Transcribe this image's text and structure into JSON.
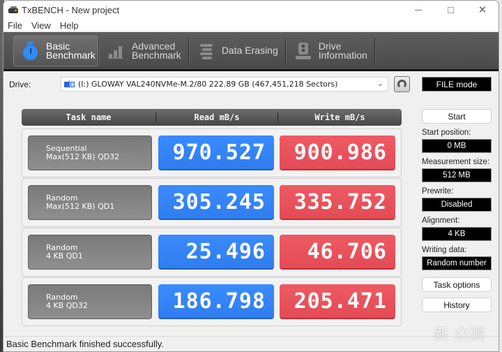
{
  "window": {
    "title": "TxBENCH - New project",
    "controls": {
      "minimize": "—",
      "maximize": "□",
      "close": "✕"
    }
  },
  "menu": [
    "File",
    "View",
    "Help"
  ],
  "toolbar": {
    "tabs": [
      {
        "line1": "Basic",
        "line2": "Benchmark",
        "icon": "stopwatch-icon",
        "active": true
      },
      {
        "line1": "Advanced",
        "line2": "Benchmark",
        "icon": "bar-chart-icon",
        "active": false
      },
      {
        "line1": "Data Erasing",
        "line2": "",
        "icon": "eraser-spring-icon",
        "active": false
      },
      {
        "line1": "Drive",
        "line2": "Information",
        "icon": "drive-info-icon",
        "active": false
      }
    ]
  },
  "drive": {
    "label": "Drive:",
    "selected": "(I:) GLOWAY VAL240NVMe-M.2/80  222.89 GB (467,451,218 Sectors)",
    "mode": "FILE mode"
  },
  "grid": {
    "headers": {
      "task": "Task name",
      "read": "Read mB/s",
      "write": "Write mB/s"
    },
    "rows": [
      {
        "line1": "Sequential",
        "line2": "Max(512 KB) QD32",
        "read": "970.527",
        "write": "900.986"
      },
      {
        "line1": "Random",
        "line2": "Max(512 KB) QD1",
        "read": "305.245",
        "write": "335.752"
      },
      {
        "line1": "Random",
        "line2": "4 KB QD1",
        "read": "25.496",
        "write": "46.706"
      },
      {
        "line1": "Random",
        "line2": "4 KB QD32",
        "read": "186.798",
        "write": "205.471"
      }
    ]
  },
  "side": {
    "start_label": "Start",
    "start_position_label": "Start position:",
    "start_position": "0 MB",
    "measurement_size_label": "Measurement size:",
    "measurement_size": "512 MB",
    "prewrite_label": "Prewrite:",
    "prewrite": "Disabled",
    "alignment_label": "Alignment:",
    "alignment": "4 KB",
    "writing_data_label": "Writing data:",
    "writing_data": "Random number",
    "task_options_label": "Task options",
    "history_label": "History"
  },
  "status": "Basic Benchmark finished successfully.",
  "watermark": "新 众测",
  "colors": {
    "read": "#3a8bff",
    "write": "#ef5a63",
    "accent": "#2f8cff"
  }
}
